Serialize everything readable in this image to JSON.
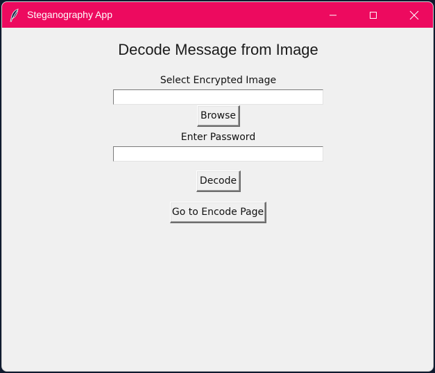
{
  "window": {
    "title": "Steganography App",
    "app_icon": "feather-icon",
    "controls": {
      "minimize_icon": "minimize-icon",
      "maximize_icon": "maximize-icon",
      "close_icon": "close-icon"
    },
    "titlebar_color": "#ed0a5f"
  },
  "page": {
    "heading": "Decode Message from Image",
    "image_field": {
      "label": "Select Encrypted Image",
      "value": ""
    },
    "browse_label": "Browse",
    "password_field": {
      "label": "Enter Password",
      "value": ""
    },
    "decode_label": "Decode",
    "encode_page_label": "Go to Encode Page"
  }
}
